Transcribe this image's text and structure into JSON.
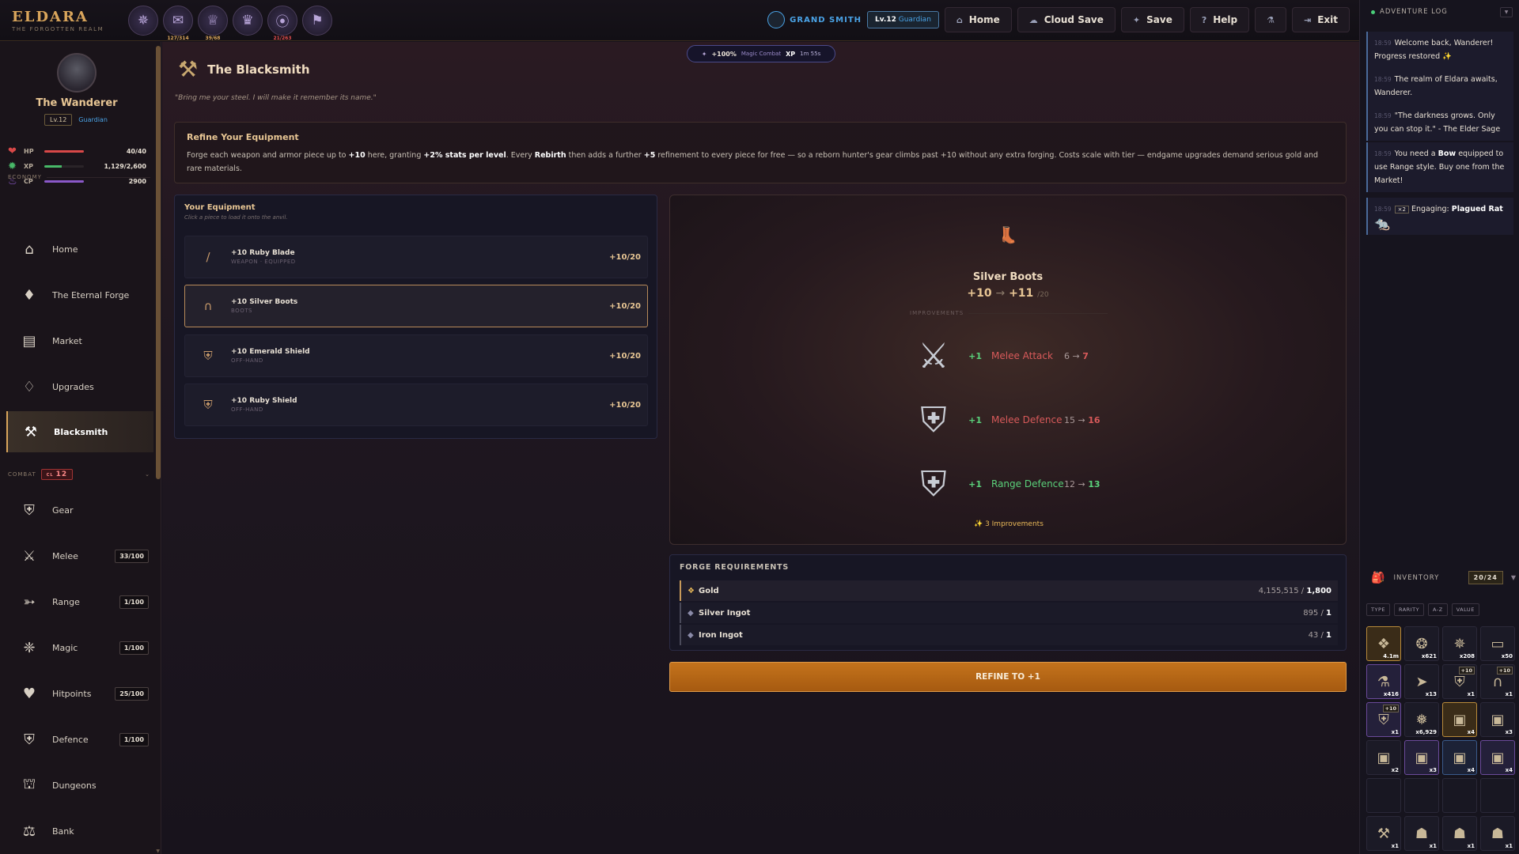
{
  "app": {
    "title": "ELDARA",
    "subtitle": "THE FORGOTTEN REALM"
  },
  "achievements": [
    {
      "icon": "emblem-icon",
      "glyph": "✵",
      "count": ""
    },
    {
      "icon": "scroll-icon",
      "glyph": "✉",
      "count": "127/314",
      "color": "gold"
    },
    {
      "icon": "trophy-icon",
      "glyph": "♕",
      "count": "39/68",
      "color": "gold"
    },
    {
      "icon": "crown-icon",
      "glyph": "♛",
      "count": ""
    },
    {
      "icon": "goggles-icon",
      "glyph": "⦿",
      "count": "21/263",
      "color": "red"
    },
    {
      "icon": "banner-icon",
      "glyph": "⚑",
      "count": ""
    }
  ],
  "header": {
    "rank": "GRAND SMITH",
    "level_badge": {
      "lv": "Lv.12",
      "class": "Guardian"
    },
    "buttons": [
      {
        "name": "home-button",
        "label": "Home",
        "icon": "home-icon",
        "glyph": "⌂"
      },
      {
        "name": "cloud-save-button",
        "label": "Cloud Save",
        "icon": "cloud-icon",
        "glyph": "☁"
      },
      {
        "name": "save-button",
        "label": "Save",
        "icon": "save-icon",
        "glyph": "✦"
      },
      {
        "name": "help-button",
        "label": "Help",
        "icon": "help-icon",
        "glyph": "?"
      },
      {
        "name": "potion-button",
        "label": "",
        "icon": "potion-icon",
        "glyph": "⚗"
      },
      {
        "name": "exit-button",
        "label": "Exit",
        "icon": "exit-icon",
        "glyph": "⇥"
      }
    ]
  },
  "player": {
    "name": "The Wanderer",
    "lv": "Lv.12",
    "class": "Guardian"
  },
  "stats": [
    {
      "label": "HP",
      "value": "40/40",
      "fill": 1.0,
      "color": "#d84848",
      "icon": "heart-icon",
      "glyph": "❤"
    },
    {
      "label": "XP",
      "value": "1,129/2,600",
      "fill": 0.43,
      "color": "#48b868",
      "icon": "star-icon",
      "glyph": "✹"
    },
    {
      "label": "CP",
      "value": "2900",
      "fill": 1.0,
      "color": "#8a58c8",
      "icon": "flame-icon",
      "glyph": "♨"
    }
  ],
  "sidebar": {
    "economy_label": "ECONOMY",
    "economy": [
      {
        "label": "Home",
        "icon": "house-icon",
        "glyph": "⌂"
      },
      {
        "label": "The Eternal Forge",
        "icon": "forge-crystal-icon",
        "glyph": "♦"
      },
      {
        "label": "Market",
        "icon": "chest-icon",
        "glyph": "▤"
      },
      {
        "label": "Upgrades",
        "icon": "gem-icon",
        "glyph": "♢"
      },
      {
        "label": "Blacksmith",
        "icon": "anvil-icon",
        "glyph": "⚒",
        "active": true
      }
    ],
    "combat_label": "COMBAT",
    "combat_level_prefix": "CL",
    "combat_level": "12",
    "combat": [
      {
        "label": "Gear",
        "icon": "shield-icon",
        "glyph": "⛨",
        "badge": ""
      },
      {
        "label": "Melee",
        "icon": "crossed-swords-icon",
        "glyph": "⚔",
        "badge": "33/100"
      },
      {
        "label": "Range",
        "icon": "bow-icon",
        "glyph": "➳",
        "badge": "1/100"
      },
      {
        "label": "Magic",
        "icon": "magic-orb-icon",
        "glyph": "❈",
        "badge": "1/100"
      },
      {
        "label": "Hitpoints",
        "icon": "heart-icon",
        "glyph": "♥",
        "badge": "25/100"
      },
      {
        "label": "Defence",
        "icon": "defence-shield-icon",
        "glyph": "⛨",
        "badge": "1/100"
      },
      {
        "label": "Dungeons",
        "icon": "dungeon-icon",
        "glyph": "⛫",
        "badge": ""
      },
      {
        "label": "Bank",
        "icon": "bank-icon",
        "glyph": "⚖",
        "badge": ""
      }
    ]
  },
  "buff": {
    "pct": "+100%",
    "type": "Magic Combat",
    "xp": "XP",
    "time": "1m 55s"
  },
  "page": {
    "title": "The Blacksmith",
    "quote": "\"Bring me your steel. I will make it remember its name.\"",
    "refine_title": "Refine Your Equipment",
    "refine_text": [
      {
        "t": "Forge each weapon and armor piece up to ",
        "b": false
      },
      {
        "t": "+10",
        "b": true
      },
      {
        "t": " here, granting ",
        "b": false
      },
      {
        "t": "+2% stats per level",
        "b": true
      },
      {
        "t": ". Every ",
        "b": false
      },
      {
        "t": "Rebirth",
        "b": true
      },
      {
        "t": " then adds a further ",
        "b": false
      },
      {
        "t": "+5",
        "b": true
      },
      {
        "t": " refinement to every piece for free — so a reborn hunter's gear climbs past +10 without any extra forging. Costs scale with tier — endgame upgrades demand serious gold and rare materials.",
        "b": false
      }
    ]
  },
  "equipment": {
    "title": "Your Equipment",
    "subtitle": "Click a piece to load it onto the anvil.",
    "items": [
      {
        "name": "+10 Ruby Blade",
        "slot": "WEAPON · EQUIPPED",
        "level": "+10/20",
        "icon": "blade-icon",
        "glyph": "∕"
      },
      {
        "name": "+10 Silver Boots",
        "slot": "BOOTS",
        "level": "+10/20",
        "icon": "boots-icon",
        "glyph": "∩",
        "selected": true
      },
      {
        "name": "+10 Emerald Shield",
        "slot": "OFF-HAND",
        "level": "+10/20",
        "icon": "shield-icon",
        "glyph": "⛨"
      },
      {
        "name": "+10 Ruby Shield",
        "slot": "OFF-HAND",
        "level": "+10/20",
        "icon": "shield-icon",
        "glyph": "⛨"
      }
    ]
  },
  "anvil": {
    "item": "Silver Boots",
    "from": "+10",
    "to": "+11",
    "max": "/20",
    "improvements_label": "IMPROVEMENTS",
    "improvements": [
      {
        "stat": "Melee Attack",
        "plus": "+1",
        "from": "6",
        "to": "7",
        "color": "#d85a5a",
        "icon": "crossed-swords-icon",
        "glyph": "⚔"
      },
      {
        "stat": "Melee Defence",
        "plus": "+1",
        "from": "15",
        "to": "16",
        "color": "#d85a5a",
        "icon": "shield-icon",
        "glyph": "⛨"
      },
      {
        "stat": "Range Defence",
        "plus": "+1",
        "from": "12",
        "to": "13",
        "color": "#5ad07a",
        "icon": "shield-icon",
        "glyph": "⛨"
      }
    ],
    "count": "✨ 3 Improvements"
  },
  "forge": {
    "title": "FORGE REQUIREMENTS",
    "items": [
      {
        "name": "Gold",
        "have": "4,155,515",
        "need": "1,800",
        "icon": "gold-icon",
        "glyph": "❖"
      },
      {
        "name": "Silver Ingot",
        "have": "895",
        "need": "1",
        "icon": "ingot-icon",
        "glyph": "◆"
      },
      {
        "name": "Iron Ingot",
        "have": "43",
        "need": "1",
        "icon": "ingot-icon",
        "glyph": "◆"
      }
    ],
    "button": "REFINE TO +1"
  },
  "log": {
    "title": "ADVENTURE LOG",
    "entries": [
      {
        "time": "18:59",
        "text": "Welcome back, Wanderer! Progress restored ✨"
      },
      {
        "time": "18:59",
        "text": "The realm of Eldara awaits, Wanderer."
      },
      {
        "time": "18:59",
        "text": "\"The darkness grows. Only you can stop it.\" - The Elder Sage"
      },
      {
        "time": "18:59",
        "pre": "You need a ",
        "bold": "Bow",
        "post": " equipped to use Range style. Buy one from the Market!"
      },
      {
        "time": "18:59",
        "mult": "×2",
        "pre": "Engaging: ",
        "bold": "Plagued Rat",
        "post": ""
      }
    ]
  },
  "inventory": {
    "title": "INVENTORY",
    "count": "20/24",
    "sorts": [
      "TYPE",
      "RARITY",
      "A-Z",
      "VALUE"
    ],
    "slots": [
      {
        "glyph": "❖",
        "q": "4.1m",
        "rarity": "gold",
        "icon": "gold-coins-icon"
      },
      {
        "glyph": "❂",
        "q": "x621",
        "rarity": "",
        "icon": "herb-icon"
      },
      {
        "glyph": "✵",
        "q": "x208",
        "rarity": "",
        "icon": "feather-icon"
      },
      {
        "glyph": "▭",
        "q": "x50",
        "rarity": "",
        "icon": "ingot-icon"
      },
      {
        "glyph": "⚗",
        "q": "x416",
        "rarity": "purple",
        "icon": "potion-icon"
      },
      {
        "glyph": "➤",
        "q": "x13",
        "rarity": "",
        "icon": "arrow-icon"
      },
      {
        "glyph": "⛨",
        "q": "x1",
        "rarity": "",
        "icon": "shield-icon",
        "plus": "+10"
      },
      {
        "glyph": "∩",
        "q": "x1",
        "rarity": "",
        "icon": "boots-icon",
        "plus": "+10"
      },
      {
        "glyph": "⛨",
        "q": "x1",
        "rarity": "purple",
        "icon": "shield-icon",
        "plus": "+10"
      },
      {
        "glyph": "❅",
        "q": "x6,929",
        "rarity": "",
        "icon": "crystal-icon"
      },
      {
        "glyph": "▣",
        "q": "x4",
        "rarity": "gold",
        "icon": "chest-icon"
      },
      {
        "glyph": "▣",
        "q": "x3",
        "rarity": "",
        "icon": "chest-icon"
      },
      {
        "glyph": "▣",
        "q": "x2",
        "rarity": "",
        "icon": "chest-icon"
      },
      {
        "glyph": "▣",
        "q": "x3",
        "rarity": "purple",
        "icon": "chest-icon"
      },
      {
        "glyph": "▣",
        "q": "x4",
        "rarity": "blue",
        "icon": "chest-icon"
      },
      {
        "glyph": "▣",
        "q": "x4",
        "rarity": "purple",
        "icon": "chest-icon"
      },
      {
        "empty": true
      },
      {
        "empty": true
      },
      {
        "empty": true
      },
      {
        "empty": true
      },
      {
        "glyph": "⚒",
        "q": "x1",
        "rarity": "",
        "icon": "anvil-icon"
      },
      {
        "glyph": "☗",
        "q": "x1",
        "rarity": "",
        "icon": "armor-icon"
      },
      {
        "glyph": "☗",
        "q": "x1",
        "rarity": "",
        "icon": "armor-icon"
      },
      {
        "glyph": "☗",
        "q": "x1",
        "rarity": "",
        "icon": "armor-icon"
      }
    ]
  }
}
